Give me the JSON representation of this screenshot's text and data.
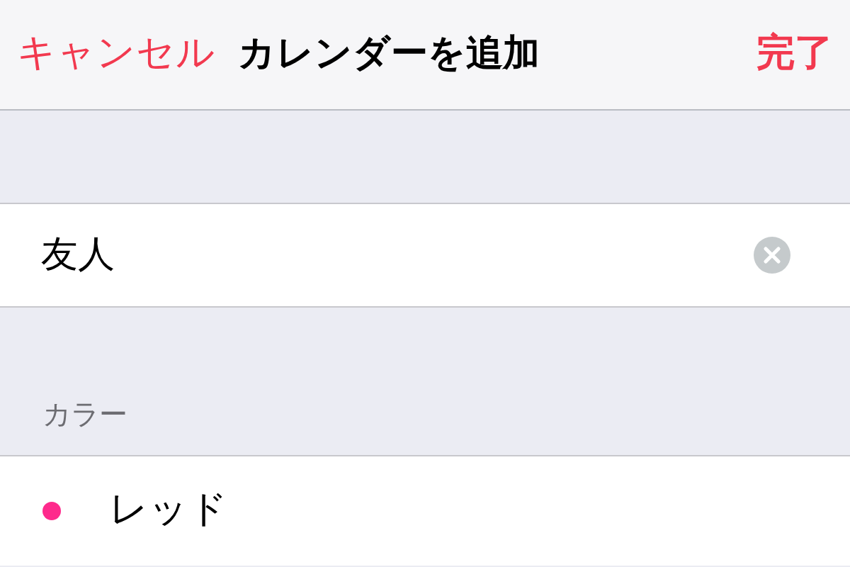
{
  "nav_bar": {
    "cancel": "キャンセル",
    "title": "カレンダーを追加",
    "done": "完了"
  },
  "name_field": {
    "value": "友人"
  },
  "color_section": {
    "header": "カラー",
    "items": [
      {
        "label": "レッド",
        "color": "#fe2a8c"
      }
    ]
  }
}
